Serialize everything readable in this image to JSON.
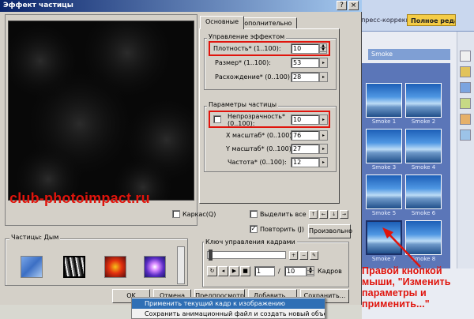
{
  "host": {
    "tab_express": "рпресс-коррекц",
    "tab_full": "Полное редак...",
    "gallery_header": "Smoke",
    "thumbs": [
      "Smoke 1",
      "Smoke 2",
      "Smoke 3",
      "Smoke 4",
      "Smoke 5",
      "Smoke 6",
      "Smoke 7",
      "Smoke 8"
    ],
    "selected_thumb": 6
  },
  "annotation": {
    "watermark": "club-photoimpact.ru",
    "note": "Правой кнопкой мыши, \"Изменить параметры и применить...\"",
    "accent": "#e0140c"
  },
  "dialog": {
    "title": "Эффект частицы",
    "title_buttons": [
      "?",
      "×"
    ],
    "tabs": [
      "Основные",
      "Дополнительно"
    ],
    "effect_group": {
      "label": "Управление эффектом",
      "rows": [
        {
          "label": "Плотность* (1..100):",
          "value": "10"
        },
        {
          "label": "Размер* (1..100):",
          "value": "53"
        },
        {
          "label": "Расхождение* (0..100):",
          "value": "28"
        }
      ]
    },
    "particle_group": {
      "label": "Параметры частицы",
      "rows": [
        {
          "label": "Непрозрачность* (0..100):",
          "value": "10"
        },
        {
          "label": "X масштаб* (0..100):",
          "value": "76"
        },
        {
          "label": "Y масштаб* (0..100):",
          "value": "27"
        },
        {
          "label": "Частота* (0..100):",
          "value": "12"
        }
      ]
    },
    "wireframe_label": "Каркас(Q)",
    "select_all_label": "Выделить все",
    "repeat_label": "Повторить (J)",
    "random_button": "Произвольно",
    "particles_label": "Частицы: Дым",
    "keyframe_label": "Ключ управления кадрами",
    "frame_current": "1",
    "frame_total": "10",
    "frames_label": "Кадров",
    "buttons": {
      "ok": "OK",
      "cancel": "Отмена",
      "preview": "Предпросмотр",
      "add": "Добавить...",
      "save": "Сохранить..."
    }
  },
  "context_menu": {
    "items": [
      "Применить текущий кадр к изображению",
      "Сохранить анимационный файл и создать новый объект..."
    ]
  }
}
